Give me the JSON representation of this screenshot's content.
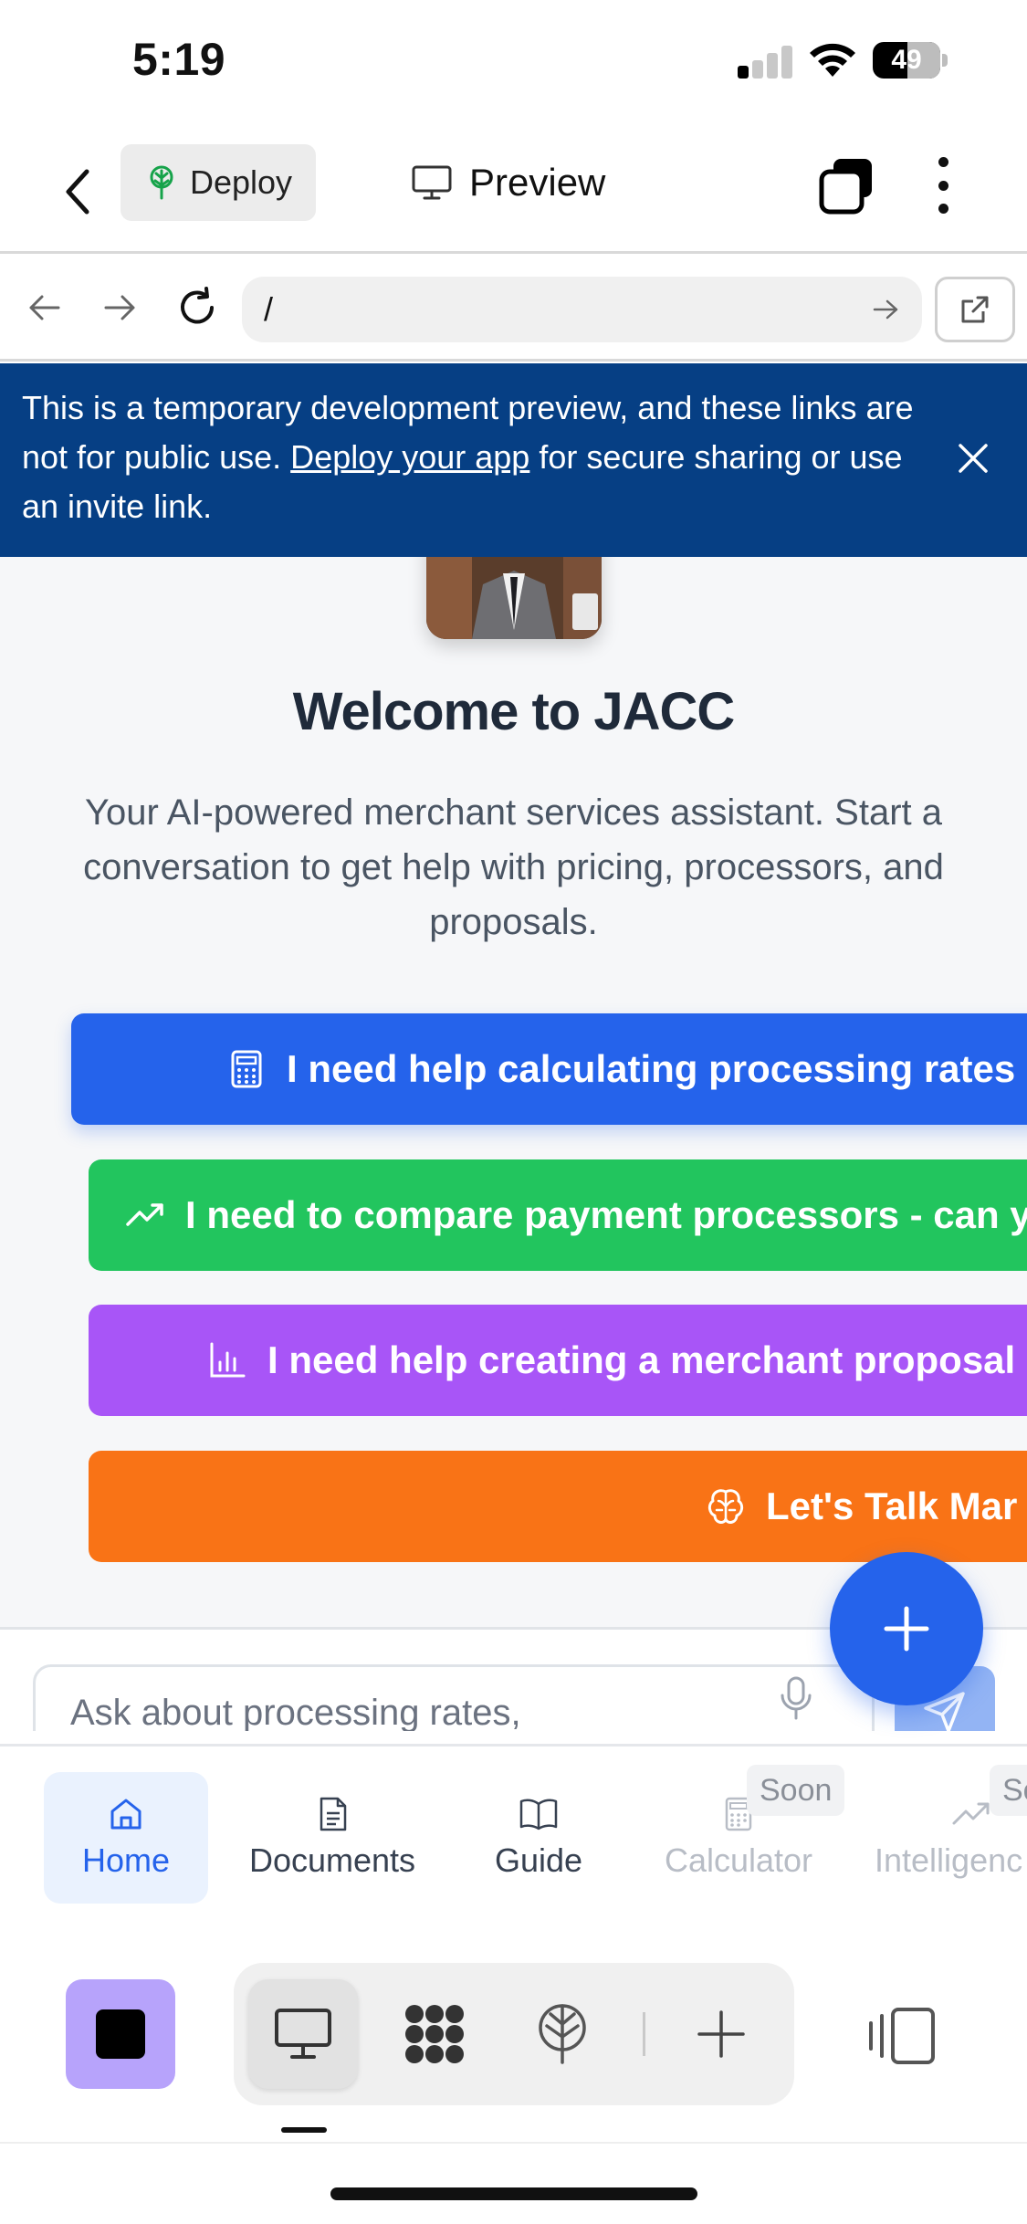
{
  "status_bar": {
    "time": "5:19",
    "battery": "49"
  },
  "header": {
    "deploy_label": "Deploy",
    "preview_label": "Preview"
  },
  "url_bar": {
    "url": "/"
  },
  "banner": {
    "text_before": "This is a temporary development preview, and these links are not for public use. ",
    "link_text": "Deploy your app",
    "text_after": " for secure sharing or use an invite link."
  },
  "welcome": {
    "title": "Welcome to JACC",
    "subtitle": "Your AI-powered merchant services assistant. Start a conversation to get help with pricing, processors, and proposals."
  },
  "prompts": [
    {
      "label": "I need help calculating processing rates",
      "icon": "calculator-icon",
      "color": "#2563eb"
    },
    {
      "label": "I need to compare payment processors - can y",
      "icon": "trending-up-icon",
      "color": "#22c55e"
    },
    {
      "label": "I need help creating a merchant proposal",
      "icon": "bar-chart-icon",
      "color": "#a855f7"
    },
    {
      "label": "Let's Talk Mar",
      "icon": "brain-icon",
      "color": "#f97316"
    }
  ],
  "chat": {
    "placeholder": "Ask about processing rates,"
  },
  "bottom_nav": {
    "items": [
      {
        "label": "Home",
        "icon": "home-icon",
        "active": true
      },
      {
        "label": "Documents",
        "icon": "document-icon"
      },
      {
        "label": "Guide",
        "icon": "book-icon"
      },
      {
        "label": "Calculator",
        "icon": "calculator-icon",
        "disabled": true,
        "badge": "Soon"
      },
      {
        "label": "Intelligenc",
        "icon": "trending-up-icon",
        "disabled": true,
        "badge": "So"
      }
    ]
  },
  "colors": {
    "accent": "#2563eb",
    "banner": "#063f84"
  }
}
